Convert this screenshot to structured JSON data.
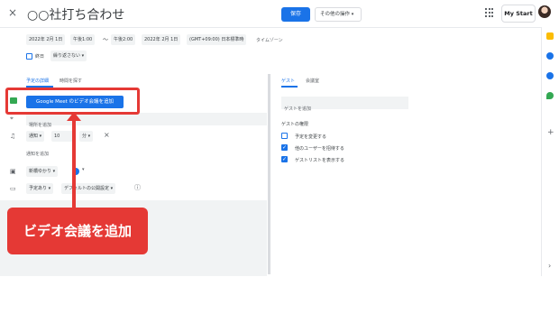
{
  "header": {
    "title": "○○社打ち合わせ",
    "close_icon": "×",
    "save_label": "保存",
    "more_actions_label": "その他の操作",
    "brand_label": "My Start"
  },
  "datetime": {
    "start_date": "2022年 2月 1日",
    "start_time": "午後1:00",
    "separator": "〜",
    "end_time": "午後2:00",
    "end_date": "2022年 2月 1日",
    "timezone": "(GMT+09:00) 日本標準時",
    "timezone_link": "タイムゾーン",
    "all_day_label": "終日",
    "repeat_label": "繰り返さない"
  },
  "tabs": {
    "details": "予定の詳細",
    "find_time": "時間を探す",
    "guests": "ゲスト",
    "rooms": "会議室"
  },
  "details": {
    "meet_button": "Google Meet のビデオ会議を追加",
    "location_placeholder": "場所を追加",
    "notification_type": "通知",
    "notification_value": "10",
    "notification_unit": "分",
    "add_notification": "通知を追加",
    "calendar_name": "新橋ゆかり",
    "availability": "予定あり",
    "visibility": "デフォルトの公開設定"
  },
  "guests_panel": {
    "add_guest_placeholder": "ゲストを追加",
    "permissions_title": "ゲストの権限",
    "permissions": [
      {
        "label": "予定を変更する",
        "checked": false
      },
      {
        "label": "他のユーザーを招待する",
        "checked": true
      },
      {
        "label": "ゲストリストを表示する",
        "checked": true
      }
    ]
  },
  "annotation": {
    "callout_text": "ビデオ会議を追加",
    "color": "#e53935"
  },
  "colors": {
    "accent": "#1a73e8",
    "annotation_red": "#e53935"
  }
}
